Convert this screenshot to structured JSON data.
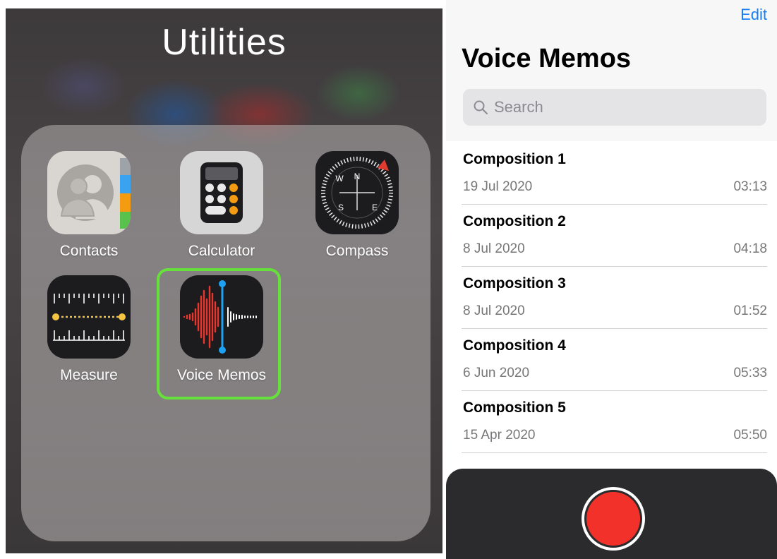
{
  "folder": {
    "title": "Utilities",
    "apps": [
      {
        "label": "Contacts",
        "icon": "contacts-icon"
      },
      {
        "label": "Calculator",
        "icon": "calculator-icon"
      },
      {
        "label": "Compass",
        "icon": "compass-icon"
      },
      {
        "label": "Measure",
        "icon": "measure-icon"
      },
      {
        "label": "Voice Memos",
        "icon": "voice-memos-icon"
      }
    ],
    "highlight_color": "#66e03a",
    "compass_letters": {
      "n": "N",
      "s": "S",
      "e": "E",
      "w": "W"
    }
  },
  "voice_memos": {
    "edit": "Edit",
    "title": "Voice Memos",
    "search_placeholder": "Search",
    "recordings": [
      {
        "title": "Composition 1",
        "date": "19 Jul 2020",
        "duration": "03:13"
      },
      {
        "title": "Composition 2",
        "date": "8 Jul 2020",
        "duration": "04:18"
      },
      {
        "title": "Composition 3",
        "date": "8 Jul 2020",
        "duration": "01:52"
      },
      {
        "title": "Composition 4",
        "date": "6 Jun 2020",
        "duration": "05:33"
      },
      {
        "title": "Composition 5",
        "date": "15 Apr 2020",
        "duration": "05:50"
      }
    ],
    "accent_color": "#1a7ff5",
    "record_color": "#f2322a"
  }
}
